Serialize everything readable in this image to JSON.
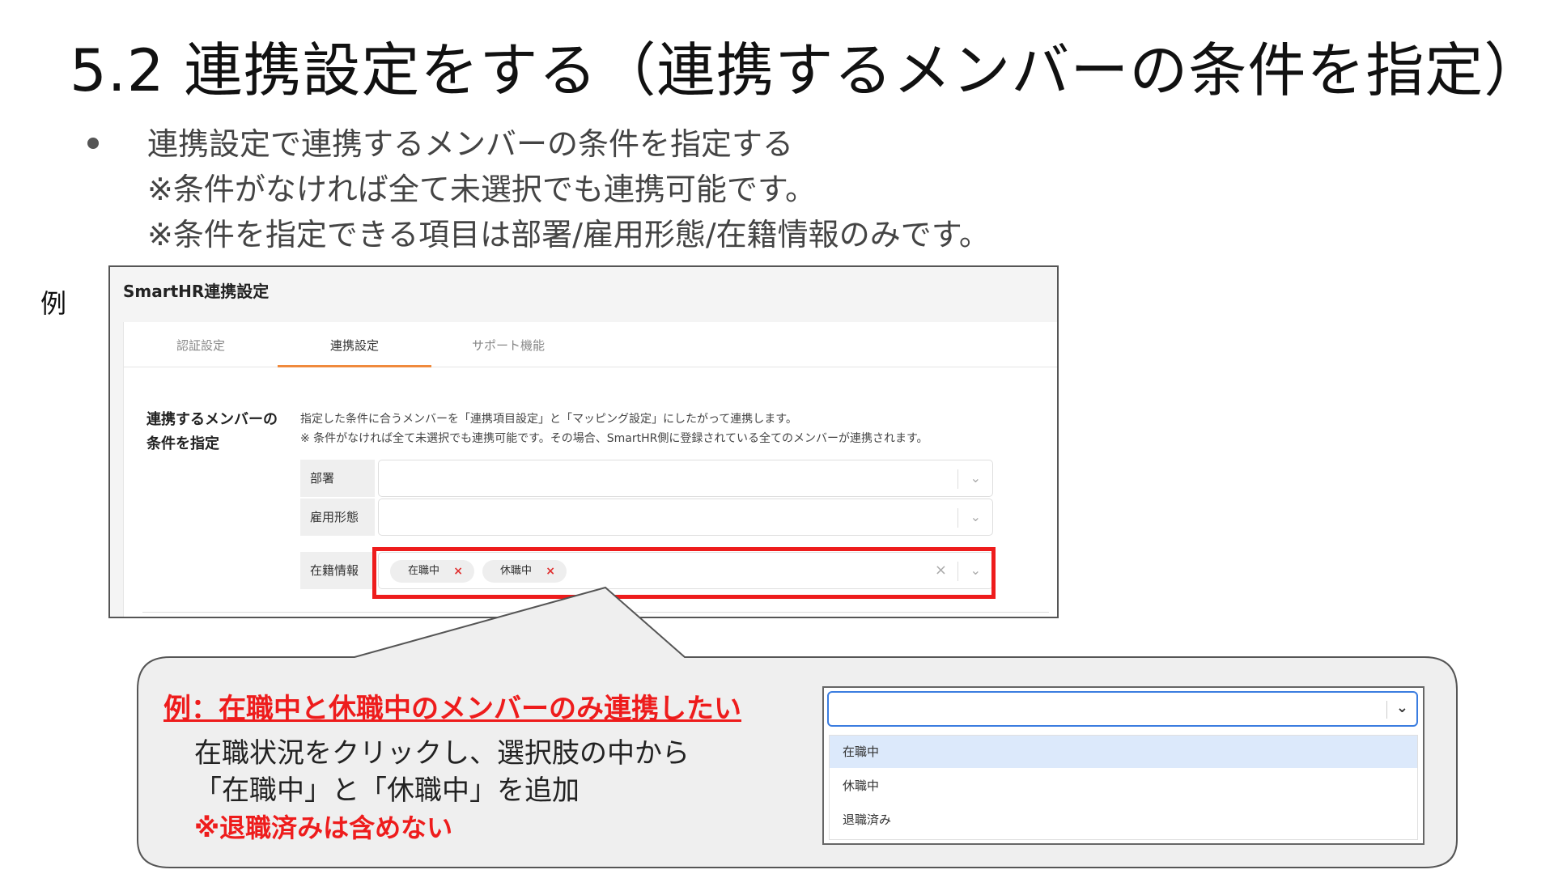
{
  "slide": {
    "title": "5.2 連携設定をする（連携するメンバーの条件を指定）",
    "bullets": [
      "連携設定で連携するメンバーの条件を指定する",
      "※条件がなければ全て未選択でも連携可能です。",
      "※条件を指定できる項目は部署/雇用形態/在籍情報のみです。"
    ],
    "example_label": "例"
  },
  "screenshot": {
    "header": "SmartHR連携設定",
    "tabs": [
      "認証設定",
      "連携設定",
      "サポート機能"
    ],
    "active_tab": "連携設定",
    "section_title_line1": "連携するメンバーの",
    "section_title_line2": "条件を指定",
    "description_line1": "指定した条件に合うメンバーを「連携項目設定」と「マッピング設定」にしたがって連携します。",
    "description_line2": "※ 条件がなければ全て未選択でも連携可能です。その場合、SmartHR側に登録されている全てのメンバーが連携されます。",
    "fields": [
      {
        "label": "部署",
        "chips": []
      },
      {
        "label": "雇用形態",
        "chips": []
      },
      {
        "label": "在籍情報",
        "chips": [
          "在職中",
          "休職中"
        ]
      }
    ],
    "chip_remove_glyph": "×",
    "clear_glyph": "×",
    "chevron_glyph": "⌄"
  },
  "callout": {
    "heading": "例：在職中と休職中のメンバーのみ連携したい",
    "body_line1": "在職状況をクリックし、選択肢の中から",
    "body_line2": "「在職中」と「休職中」を追加",
    "note": "※退職済みは含めない"
  },
  "dropdown": {
    "chevron_glyph": "⌄",
    "options": [
      "在職中",
      "休職中",
      "退職済み"
    ],
    "highlighted": "在職中"
  },
  "colors": {
    "accent_red": "#ee1c1c",
    "tab_underline": "#f08a3c",
    "focus_blue": "#3b7de0",
    "highlight_blue": "#dce9fb"
  }
}
